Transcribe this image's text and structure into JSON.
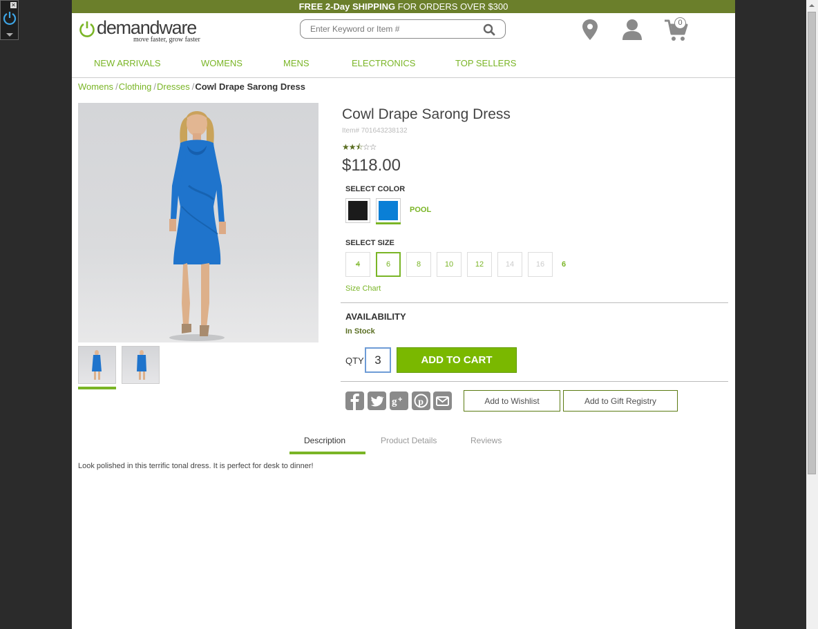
{
  "promo": {
    "free_text": "FREE",
    "twoday_text": "2-Day",
    "shipping_text": "SHIPPING",
    "rest_text": "FOR ORDERS OVER",
    "amount_text": "$300"
  },
  "logo": {
    "brand": "demandware",
    "tagline": "move faster, grow faster"
  },
  "search": {
    "placeholder": "Enter Keyword or Item #"
  },
  "header": {
    "cart_count": "0"
  },
  "nav": {
    "items": [
      "NEW ARRIVALS",
      "WOMENS",
      "MENS",
      "ELECTRONICS",
      "TOP SELLERS"
    ]
  },
  "breadcrumb": {
    "items": [
      "Womens",
      "Clothing",
      "Dresses"
    ],
    "separator": "/",
    "current": "Cowl Drape Sarong Dress"
  },
  "product": {
    "name": "Cowl Drape Sarong Dress",
    "item_number": "Item# 701643238132",
    "rating": 2.5,
    "rating_max": 5,
    "price": "$118.00",
    "select_color_label": "SELECT COLOR",
    "colors": [
      {
        "name": "black",
        "hex": "#1b1b1b",
        "selected": false
      },
      {
        "name": "pool",
        "hex": "#0a7fd6",
        "selected": true
      }
    ],
    "selected_color": "POOL",
    "select_size_label": "SELECT SIZE",
    "sizes": [
      {
        "label": "4",
        "state": "unavailable"
      },
      {
        "label": "6",
        "state": "selected"
      },
      {
        "label": "8",
        "state": "available"
      },
      {
        "label": "10",
        "state": "available"
      },
      {
        "label": "12",
        "state": "available"
      },
      {
        "label": "14",
        "state": "disabled"
      },
      {
        "label": "16",
        "state": "disabled"
      }
    ],
    "selected_size": "6",
    "size_chart_label": "Size Chart",
    "availability_label": "AVAILABILITY",
    "stock_status": "In Stock",
    "qty_label": "QTY",
    "qty_value": "3",
    "add_to_cart_label": "ADD TO CART",
    "wishlist_label": "Add to Wishlist",
    "gift_registry_label": "Add to Gift Registry",
    "share_icons": [
      "facebook-icon",
      "twitter-icon",
      "google-plus-icon",
      "pinterest-icon",
      "email-icon"
    ]
  },
  "tabs": {
    "items": [
      "Description",
      "Product Details",
      "Reviews"
    ],
    "active": "Description"
  },
  "description": {
    "text": "Look polished in this terrific tonal dress. It is perfect for desk to dinner!"
  },
  "colors": {
    "accent": "#7ab526",
    "promo_bg": "#6b7f2b",
    "button_green": "#7ab800",
    "icon_gray": "#8a8a8a"
  }
}
